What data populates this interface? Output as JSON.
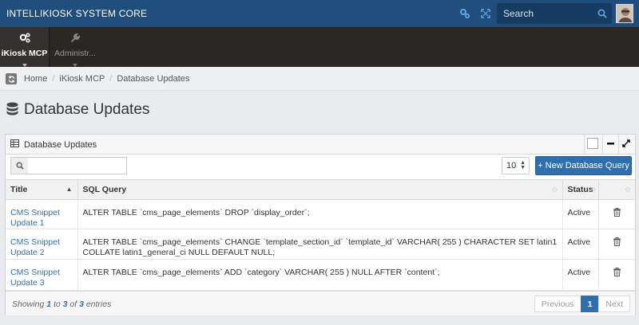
{
  "app": {
    "title": "INTELLIKIOSK SYSTEM CORE"
  },
  "topbar": {
    "search_placeholder": "Search",
    "icons": [
      "gears-icon",
      "expand-icon",
      "search-icon"
    ]
  },
  "modules": [
    {
      "label": "iKiosk MCP",
      "icon": "cogs-icon",
      "active": true
    },
    {
      "label": "Administr...",
      "icon": "wrench-icon",
      "active": false
    }
  ],
  "breadcrumb": {
    "items": [
      "Home",
      "iKiosk MCP",
      "Database Updates"
    ]
  },
  "page": {
    "title": "Database Updates"
  },
  "panel": {
    "title": "Database Updates",
    "page_length": "10",
    "new_button": "+ New Database Query",
    "columns": [
      "Title",
      "SQL Query",
      "Status",
      ""
    ],
    "rows": [
      {
        "title": "CMS Snippet Update 1",
        "sql": "ALTER TABLE `cms_page_elements` DROP `display_order`;",
        "status": "Active"
      },
      {
        "title": "CMS Snippet Update 2",
        "sql": "ALTER TABLE `cms_page_elements` CHANGE `template_section_id` `template_id` VARCHAR( 255 ) CHARACTER SET latin1 COLLATE latin1_general_ci NULL DEFAULT NULL;",
        "status": "Active"
      },
      {
        "title": "CMS Snippet Update 3",
        "sql": "ALTER TABLE `cms_page_elements` ADD `category` VARCHAR( 255 ) NULL AFTER `content`;",
        "status": "Active"
      }
    ],
    "footer": {
      "showing_prefix": "Showing ",
      "from": "1",
      "to_word": " to ",
      "to": "3",
      "of_word": " of ",
      "total": "3",
      "suffix": " entries"
    },
    "pager": {
      "previous": "Previous",
      "current": "1",
      "next": "Next"
    }
  },
  "colors": {
    "topbar": "#1f4e7c",
    "accent": "#2f6fae",
    "modnav": "#2b2724"
  }
}
